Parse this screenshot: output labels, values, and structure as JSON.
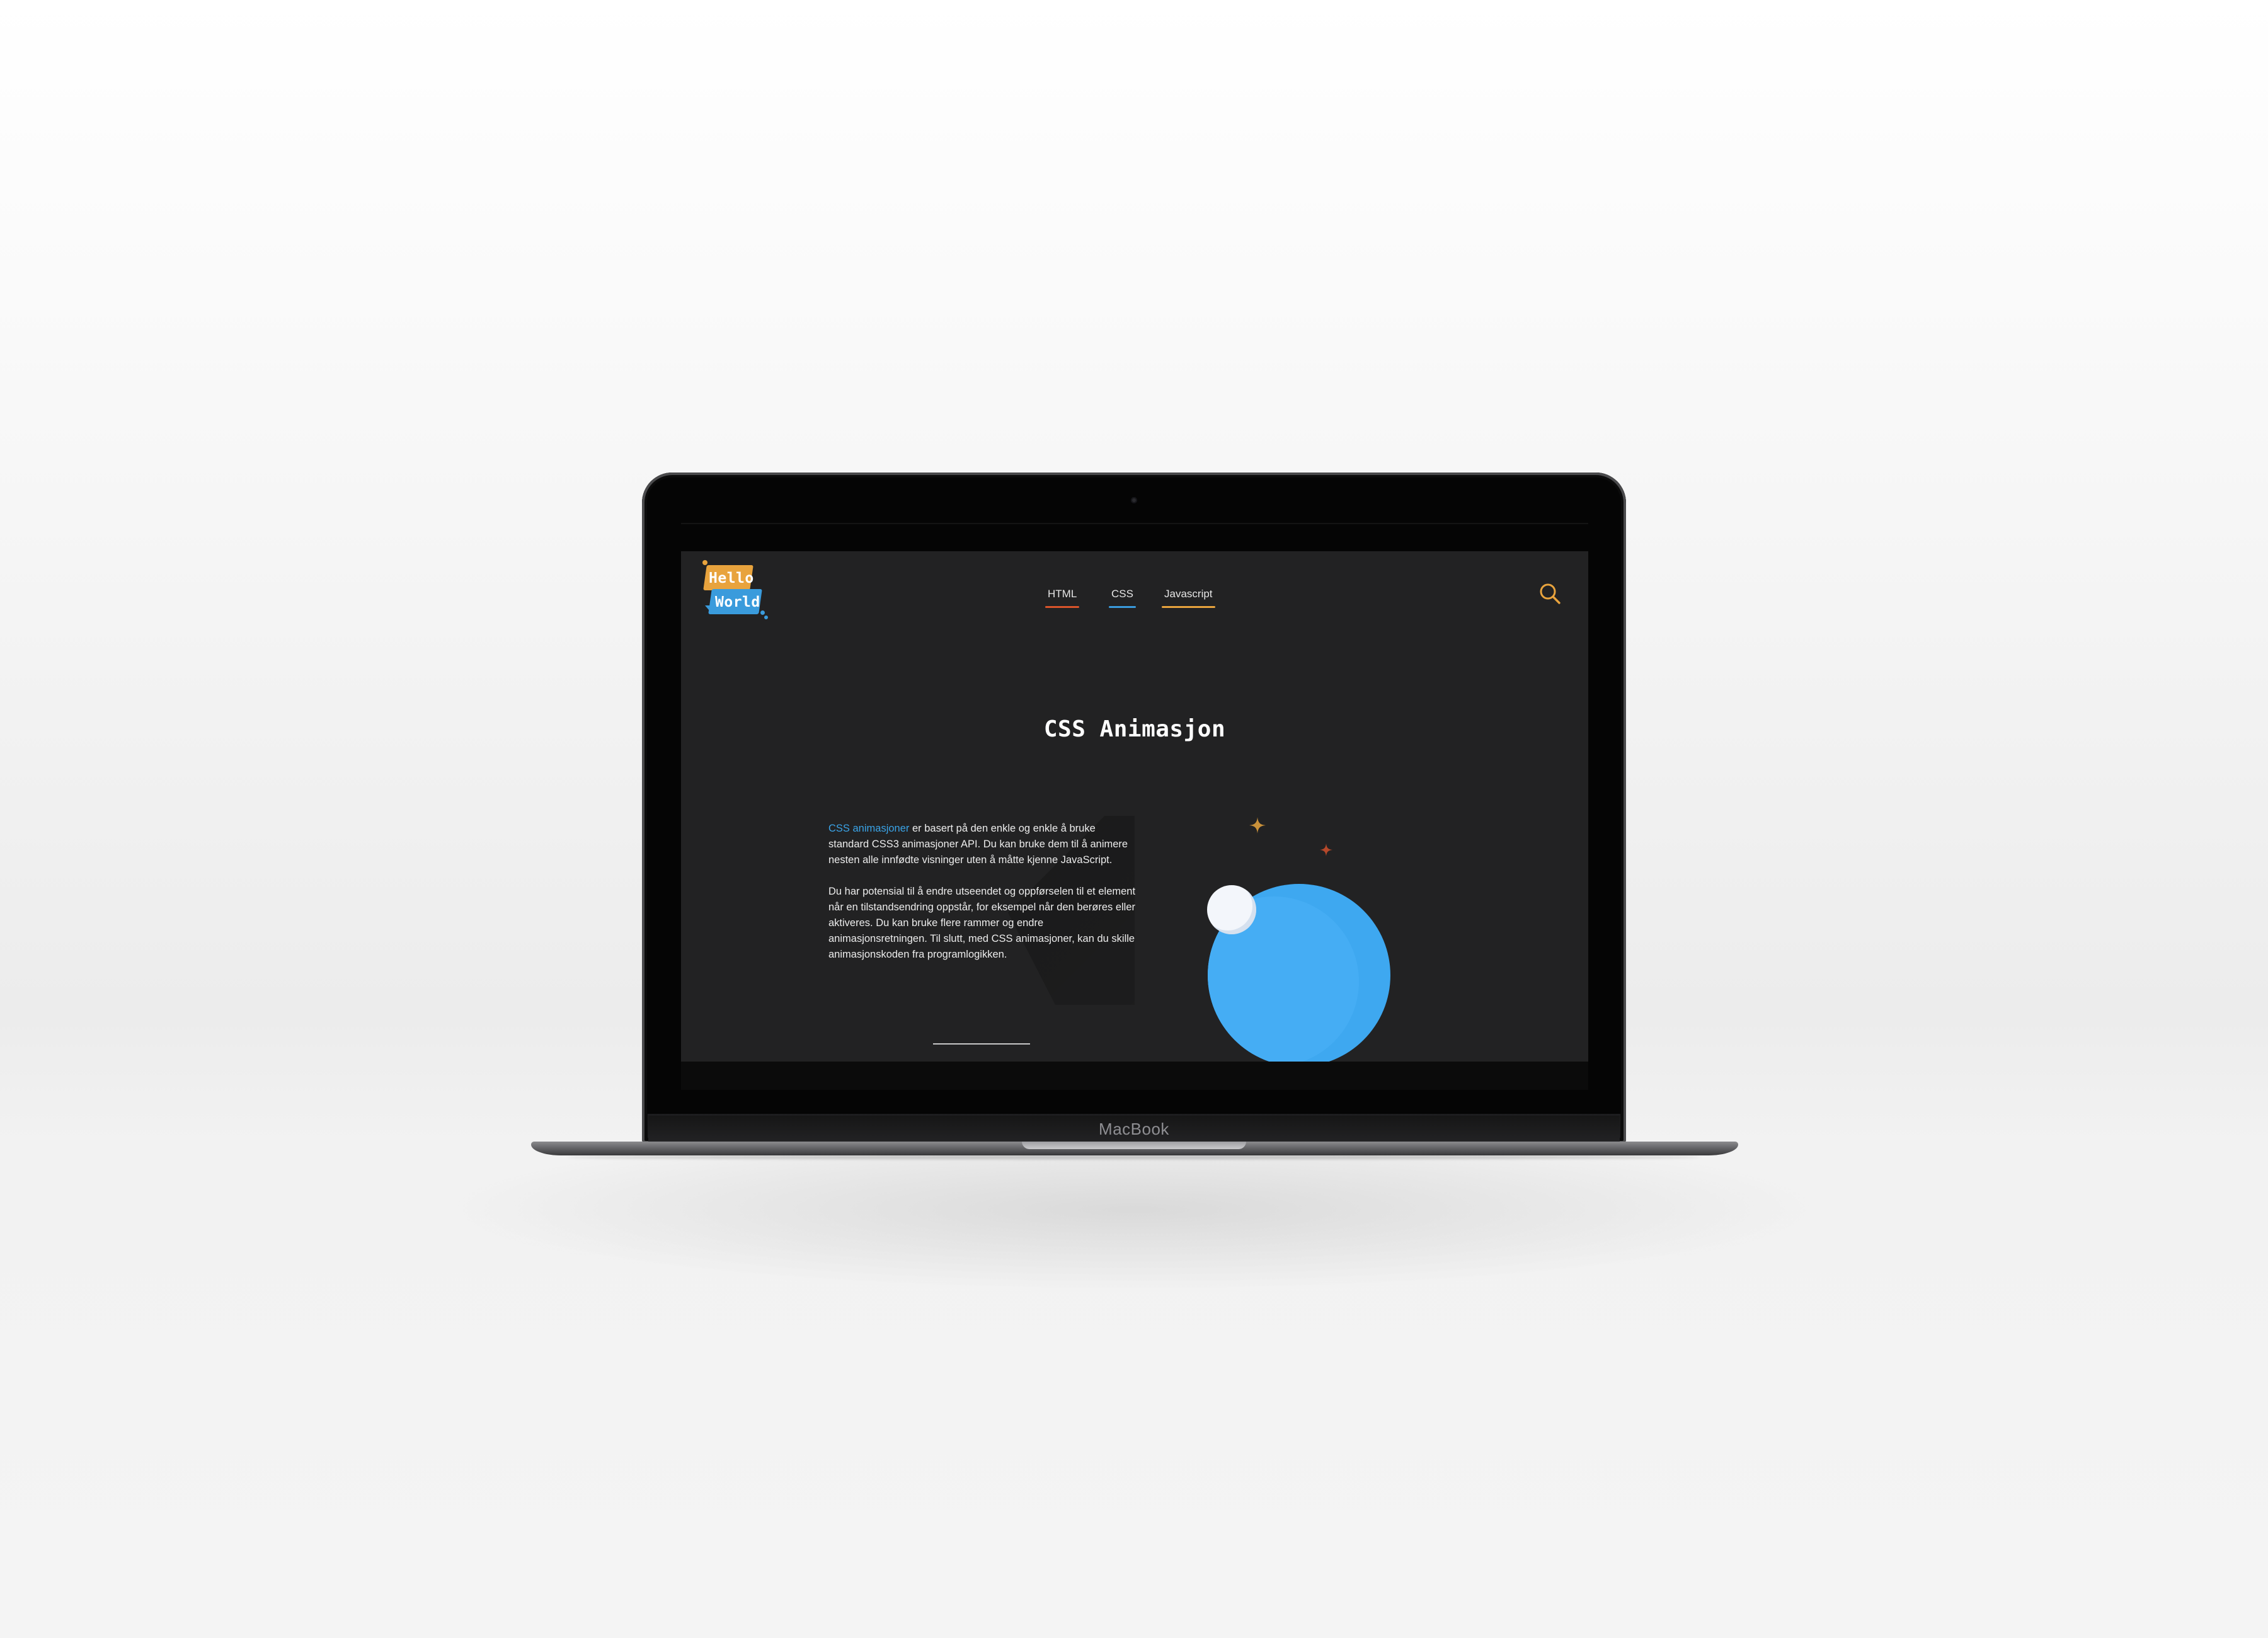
{
  "device": {
    "brand_label": "MacBook"
  },
  "header": {
    "logo": {
      "line1": "Hello",
      "line2": "World",
      "colors": {
        "top": "#e8a33d",
        "bottom": "#3a9bdc"
      }
    },
    "nav": [
      {
        "label": "HTML",
        "underline_color": "#d9542b"
      },
      {
        "label": "CSS",
        "underline_color": "#3a9bdc"
      },
      {
        "label": "Javascript",
        "underline_color": "#e8a33d"
      }
    ],
    "search_icon": "search-icon",
    "search_color": "#e8a33d"
  },
  "main": {
    "title": "CSS Animasjon",
    "paragraph1": {
      "link": "CSS animasjoner",
      "text": " er basert på den enkle og enkle å bruke standard CSS3 animasjoner API. Du kan bruke dem til å animere nesten alle innfødte visninger uten å måtte kjenne JavaScript."
    },
    "paragraph2": "Du har potensial til å endre utseendet og oppførselen til et element når en tilstandsendring oppstår, for eksempel når den berøres eller aktiveres. Du kan bruke flere rammer og endre animasjonsretningen. Til slutt, med CSS animasjoner, kan du skille animasjonskoden fra programlogikken."
  },
  "colors": {
    "background": "#222223",
    "accent_blue": "#3ea8f0",
    "accent_orange": "#e8a33d",
    "accent_red": "#d9542b"
  }
}
